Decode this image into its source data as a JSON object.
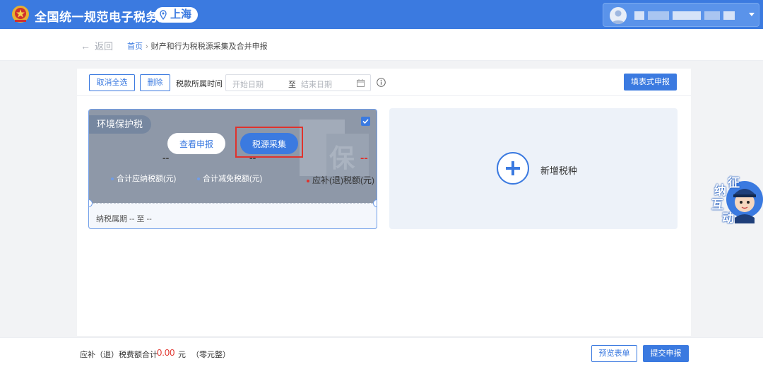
{
  "header": {
    "site_title": "全国统一规范电子税务局",
    "region": "上海",
    "logo_icon": "tax-emblem-icon",
    "user_icon": "user-avatar-icon"
  },
  "nav": {
    "back_label": "返回",
    "breadcrumb_home": "首页",
    "breadcrumb_sep": "›",
    "breadcrumb_current": "财产和行为税税源采集及合并申报"
  },
  "toolbar": {
    "deselect_all": "取消全选",
    "delete": "删除",
    "period_label": "税款所属时间",
    "start_placeholder": "开始日期",
    "range_sep": "至",
    "end_placeholder": "结束日期",
    "fill_form_button": "填表式申报"
  },
  "tax_card": {
    "tax_name": "环境保护税",
    "watermark": "保",
    "view_button": "查看申报",
    "collect_button": "税源采集",
    "amounts": [
      {
        "value": "--",
        "label": "合计应纳税额(元)"
      },
      {
        "value": "--",
        "label": "合计减免税额(元)"
      },
      {
        "value": "--",
        "label": "应补(退)税额(元)"
      }
    ],
    "period": "纳税属期 -- 至 --"
  },
  "add_card": {
    "label": "新增税种"
  },
  "float_widget": {
    "chars": [
      "征",
      "纳",
      "互",
      "动"
    ]
  },
  "footer": {
    "total_label": "应补（退）税费额合计",
    "total_value": "0.00",
    "unit": "元",
    "in_words": "（零元整）",
    "preview_button": "预览表单",
    "submit_button": "提交申报"
  },
  "colors": {
    "primary": "#3b7ae0",
    "danger": "#e0322c"
  }
}
